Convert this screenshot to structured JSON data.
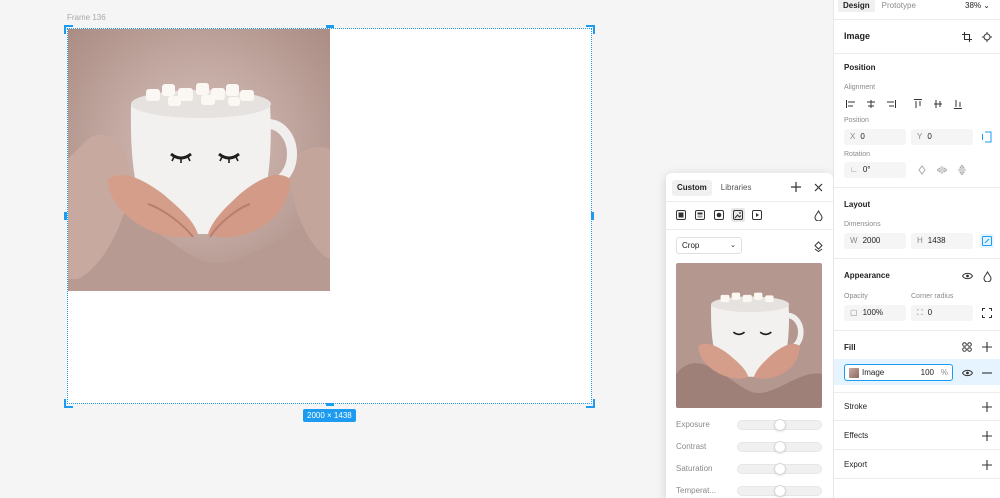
{
  "canvas": {
    "frame_label": "Frame 136",
    "dimensions_badge": "2000 × 1438"
  },
  "picker": {
    "tabs": [
      "Custom",
      "Libraries"
    ],
    "active_tab": "Custom",
    "fill_type_icons": [
      "solid-fill-icon",
      "linear-gradient-icon",
      "radial-gradient-icon",
      "image-fill-icon",
      "video-fill-icon"
    ],
    "mode_select": "Crop",
    "adjustments": [
      {
        "label": "Exposure",
        "value": 0
      },
      {
        "label": "Contrast",
        "value": 0
      },
      {
        "label": "Saturation",
        "value": 0
      },
      {
        "label": "Temperat...",
        "value": 0
      }
    ]
  },
  "panel": {
    "tabs": [
      "Design",
      "Prototype"
    ],
    "active_tab": "Design",
    "zoom": "38%",
    "layer_type": "Image",
    "position": {
      "title": "Position",
      "alignment_label": "Alignment",
      "position_label": "Position",
      "x_prefix": "X",
      "x": "0",
      "y_prefix": "Y",
      "y": "0",
      "rotation_label": "Rotation",
      "rotation": "0°"
    },
    "layout": {
      "title": "Layout",
      "dimensions_label": "Dimensions",
      "w_prefix": "W",
      "w": "2000",
      "h_prefix": "H",
      "h": "1438"
    },
    "appearance": {
      "title": "Appearance",
      "opacity_label": "Opacity",
      "opacity": "100%",
      "radius_label": "Corner radius",
      "radius": "0"
    },
    "fill": {
      "title": "Fill",
      "name": "Image",
      "opacity": "100",
      "unit": "%"
    },
    "stroke_title": "Stroke",
    "effects_title": "Effects",
    "export_title": "Export"
  },
  "colors": {
    "accent": "#1d9bf0",
    "canvas": "#f5f5f5"
  }
}
